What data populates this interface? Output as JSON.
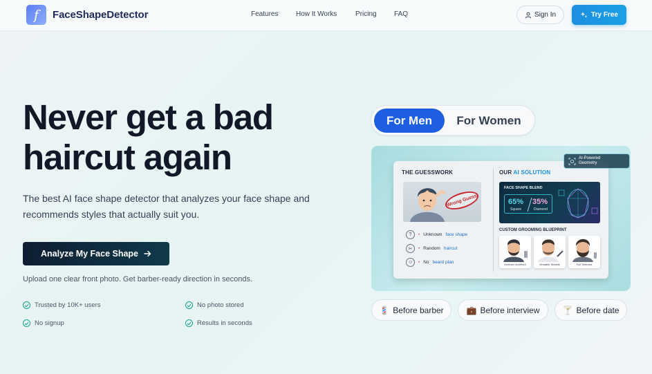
{
  "header": {
    "logo_glyph": "f",
    "brand": "FaceShapeDetector",
    "nav": [
      "Features",
      "How It Works",
      "Pricing",
      "FAQ"
    ],
    "signin_label": "Sign In",
    "tryfree_label": "Try Free"
  },
  "hero": {
    "headline_line1": "Never get a bad",
    "headline_line2": "haircut again",
    "subtext": "The best AI face shape detector that analyzes your face shape and recommends styles that actually suit you.",
    "cta_label": "Analyze My Face Shape",
    "upload_note": "Upload one clear front photo. Get barber-ready direction in seconds.",
    "features": [
      "Trusted by 10K+ users",
      "No photo stored",
      "No signup",
      "Results in seconds"
    ]
  },
  "toggle": {
    "men_label": "For Men",
    "women_label": "For Women",
    "selected": "For Men"
  },
  "preview": {
    "badge": [
      "AI-Powered",
      "Geometry"
    ],
    "left_title": "THE GUESSWORK",
    "stamp": "Wrong Guess",
    "guess_items": [
      {
        "pre": "Unknown",
        "hl": "face shape"
      },
      {
        "pre": "Random",
        "hl": "haircut"
      },
      {
        "pre": "No",
        "hl": "beard plan"
      }
    ],
    "right_title_a": "OUR ",
    "right_title_b": "AI SOLUTION",
    "blend_title": "FACE SHAPE BLEND",
    "blend": [
      {
        "pct": "65%",
        "label": "Square"
      },
      {
        "pct": "35%",
        "label": "Diamond"
      }
    ],
    "blueprint_title": "CUSTOM GROOMING BLUEPRINT",
    "blueprint_cards": [
      "Defined Undercut",
      "Versatile Stubble",
      "Full Textured"
    ]
  },
  "chips": [
    {
      "icon": "barber-pole-icon",
      "glyph": "💈",
      "label": "Before barber"
    },
    {
      "icon": "briefcase-icon",
      "glyph": "💼",
      "label": "Before interview"
    },
    {
      "icon": "cocktail-icon",
      "glyph": "🍸",
      "label": "Before date"
    }
  ],
  "colors": {
    "primary": "#1d5fe0",
    "accent": "#1d8fe0",
    "cta_dark": "#0f1e33",
    "check": "#14a38b"
  }
}
